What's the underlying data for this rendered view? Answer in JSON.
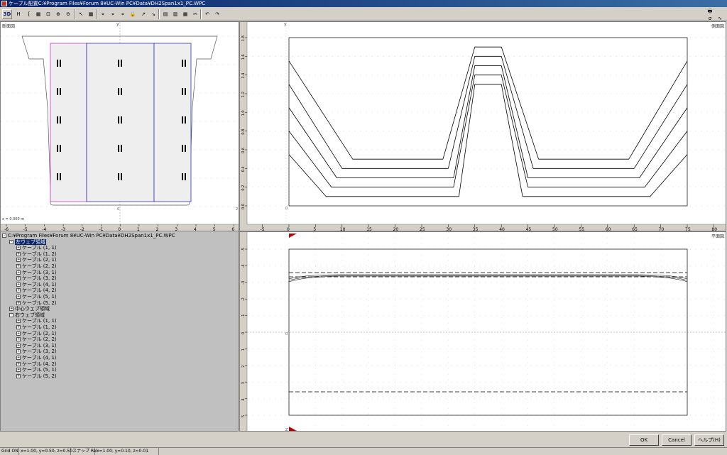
{
  "window": {
    "title": "ケーブル配置C:¥Program Files¥Forum 8¥UC-Win PC¥Data¥DH2Span1x1_PC.WPC"
  },
  "toolbar": {
    "buttons": [
      {
        "name": "3d-view-button",
        "label": "3D",
        "icon": "3d-text-icon"
      },
      {
        "name": "bold-button",
        "label": "H",
        "icon": "h-icon"
      },
      {
        "name": "bracket-button",
        "label": "[",
        "icon": "bracket-icon"
      },
      {
        "name": "grid-toggle-button",
        "label": "▦",
        "icon": "grid-icon"
      },
      {
        "name": "fit-button",
        "label": "⊡",
        "icon": "fit-icon"
      },
      {
        "name": "zoom-in-button",
        "label": "⊕",
        "icon": "zoom-in-icon"
      },
      {
        "name": "zoom-out-button",
        "label": "⊖",
        "icon": "zoom-out-icon"
      },
      {
        "name": "pointer-button",
        "label": "↖",
        "icon": "pointer-icon"
      },
      {
        "name": "grid-snap-button",
        "label": "▩",
        "icon": "grid-snap-icon"
      },
      {
        "name": "node-add-button",
        "label": "⋄",
        "icon": "node-add-icon"
      },
      {
        "name": "node-move-button",
        "label": "⋄",
        "icon": "node-move-icon"
      },
      {
        "name": "node-delete-button",
        "label": "⋄",
        "icon": "node-delete-icon"
      },
      {
        "name": "lock-button",
        "label": "🔒",
        "icon": "lock-icon"
      },
      {
        "name": "arrow-up-button",
        "label": "↗",
        "icon": "arrow-up-icon"
      },
      {
        "name": "arrow-down-button",
        "label": "↘",
        "icon": "arrow-down-icon"
      },
      {
        "name": "table-button",
        "label": "▤",
        "icon": "table-icon"
      },
      {
        "name": "calc-button",
        "label": "▥",
        "icon": "calc-icon"
      },
      {
        "name": "chart-button",
        "label": "▦",
        "icon": "chart-icon"
      },
      {
        "name": "cut-button",
        "label": "✂",
        "icon": "scissors-icon"
      },
      {
        "name": "undo-button",
        "label": "↶",
        "icon": "undo-icon"
      },
      {
        "name": "redo-button",
        "label": "↷",
        "icon": "redo-icon"
      }
    ],
    "right_buttons": [
      {
        "name": "print-button",
        "label": "🖶",
        "icon": "printer-icon"
      },
      {
        "name": "sigma-button",
        "label": "σ",
        "icon": "sigma-icon"
      },
      {
        "name": "curve-button",
        "label": "∿",
        "icon": "curve-icon"
      }
    ]
  },
  "panes": {
    "section": {
      "label": "断面図",
      "status": "x = 0.000 m",
      "x_ticks": [
        "-6",
        "-5",
        "-4",
        "-3",
        "-2",
        "-1",
        "0",
        "1",
        "2",
        "3",
        "4",
        "5",
        "6"
      ],
      "origin_label": "0",
      "y_axis_label": "Y",
      "edge_label": "2"
    },
    "side": {
      "label": "側面図",
      "x_ticks": [
        "-5",
        "0",
        "5",
        "10",
        "15",
        "20",
        "25",
        "30",
        "35",
        "40",
        "45",
        "50",
        "55",
        "60",
        "65",
        "70",
        "75",
        "80"
      ],
      "y_ticks": [
        "0.0",
        "0.2",
        "0.4",
        "0.6",
        "0.8",
        "1.0",
        "1.2",
        "1.4",
        "1.6",
        "1.8"
      ],
      "axis_label": "Y",
      "origin_label": "0"
    },
    "plan": {
      "label": "平面図",
      "y_ticks": [
        "-5",
        "-4",
        "-3",
        "-2",
        "-1",
        "0",
        "1",
        "2",
        "3",
        "4",
        "5"
      ],
      "axis_label": "Z",
      "origin_label": "0"
    }
  },
  "tree": {
    "root": "C:¥Program Files¥Forum 8¥UC-Win PC¥Data¥DH2Span1x1_PC.WPC",
    "groups": [
      {
        "label": "左ウェブ領域",
        "selected": true,
        "items": [
          "ケーブル (1, 1)",
          "ケーブル (1, 2)",
          "ケーブル (2, 1)",
          "ケーブル (2, 2)",
          "ケーブル (3, 1)",
          "ケーブル (3, 2)",
          "ケーブル (4, 1)",
          "ケーブル (4, 2)",
          "ケーブル (5, 1)",
          "ケーブル (5, 2)"
        ]
      },
      {
        "label": "中心ウェブ領域",
        "selected": false,
        "items": []
      },
      {
        "label": "右ウェブ領域",
        "selected": false,
        "items": [
          "ケーブル (1, 1)",
          "ケーブル (1, 2)",
          "ケーブル (2, 1)",
          "ケーブル (2, 2)",
          "ケーブル (3, 1)",
          "ケーブル (3, 2)",
          "ケーブル (4, 1)",
          "ケーブル (4, 2)",
          "ケーブル (5, 1)",
          "ケーブル (5, 2)"
        ]
      }
    ]
  },
  "buttons": {
    "ok": "OK",
    "cancel": "Cancel",
    "help": "ヘルプ(H)"
  },
  "status": {
    "grid": "Grid ON",
    "grid_spacing": "x=1.00, y=0.50, z=0.50",
    "snap_label": "スナップ Rel",
    "snap_values": "x=1.00, y=0.10, z=0.01"
  },
  "chart_data": {
    "type": "line",
    "title": "",
    "xlabel": "",
    "ylabel": "Y",
    "xlim": [
      0,
      75
    ],
    "ylim": [
      0,
      1.8
    ],
    "series": [
      {
        "x": [
          0,
          12,
          29,
          35,
          40,
          47,
          64,
          75
        ],
        "y": [
          1.55,
          0.5,
          0.5,
          1.7,
          1.7,
          0.5,
          0.5,
          1.55
        ]
      },
      {
        "x": [
          0,
          10,
          30,
          35,
          40,
          46,
          65,
          75
        ],
        "y": [
          1.3,
          0.4,
          0.4,
          1.6,
          1.6,
          0.4,
          0.4,
          1.3
        ]
      },
      {
        "x": [
          0,
          9,
          31,
          35,
          40,
          45,
          66,
          75
        ],
        "y": [
          1.05,
          0.3,
          0.3,
          1.5,
          1.5,
          0.3,
          0.3,
          1.05
        ]
      },
      {
        "x": [
          0,
          8,
          31,
          35,
          40,
          45,
          67,
          75
        ],
        "y": [
          0.8,
          0.2,
          0.2,
          1.4,
          1.4,
          0.2,
          0.2,
          0.8
        ]
      },
      {
        "x": [
          0,
          7,
          32,
          35,
          40,
          44,
          68,
          75
        ],
        "y": [
          0.55,
          0.1,
          0.1,
          1.3,
          1.3,
          0.1,
          0.1,
          0.55
        ]
      }
    ]
  }
}
